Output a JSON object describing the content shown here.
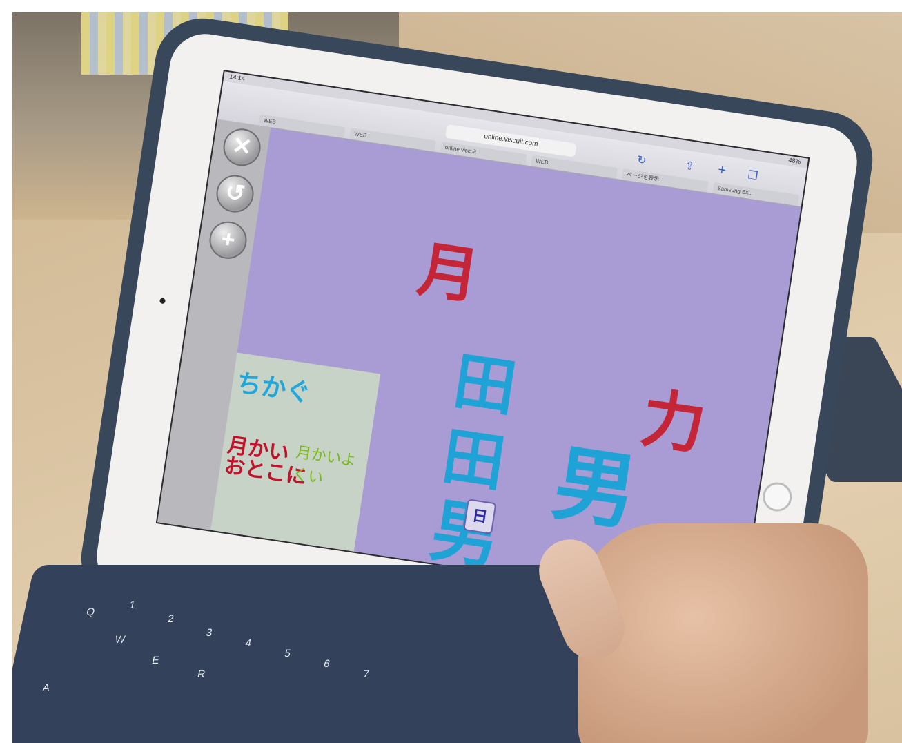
{
  "screen": {
    "url": "online.viscuit.com",
    "status_time": "14:14",
    "battery": "48%",
    "tabs": [
      "WEB",
      "WEB",
      "online.viscuit",
      "WEB",
      "ページを表示",
      "Samsung Ex..."
    ]
  },
  "tools": {
    "close_glyph": "✕",
    "undo_glyph": "↺",
    "add_glyph": "+"
  },
  "drawing": {
    "tsuki": "月",
    "chikara": "力",
    "ta": "田",
    "otoko": "男",
    "cube_label": "日",
    "note_blue": "ちかぐ",
    "note_red": "月かい\nおとこに",
    "note_green": "月かいよくい"
  },
  "keyboard": {
    "keys": [
      "Q",
      "W",
      "E",
      "R",
      "A",
      "1",
      "2",
      "3",
      "4",
      "5",
      "6",
      "7"
    ]
  }
}
